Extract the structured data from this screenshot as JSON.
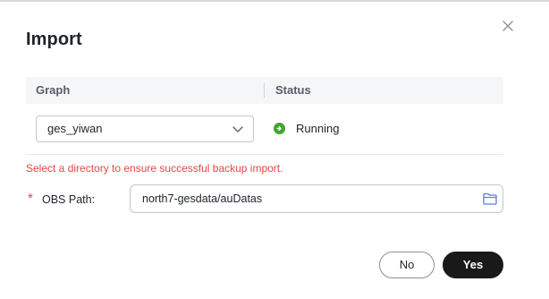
{
  "dialog": {
    "title": "Import",
    "close_icon": "close-icon"
  },
  "table": {
    "columns": [
      "Graph",
      "Status"
    ],
    "row": {
      "graph_selected": "ges_yiwan",
      "status": "Running",
      "status_icon": "running-status-icon",
      "status_color": "#3fa62e"
    }
  },
  "warning": {
    "text": "Select a directory to ensure successful backup import.",
    "color": "#e54545"
  },
  "obs_path": {
    "required_mark": "*",
    "label": "OBS Path:",
    "value": "north7-gesdata/auDatas",
    "icon": "folder-icon"
  },
  "buttons": {
    "no": "No",
    "yes": "Yes"
  },
  "colors": {
    "primary_button": "#191919",
    "link_icon": "#5e7ce0"
  }
}
